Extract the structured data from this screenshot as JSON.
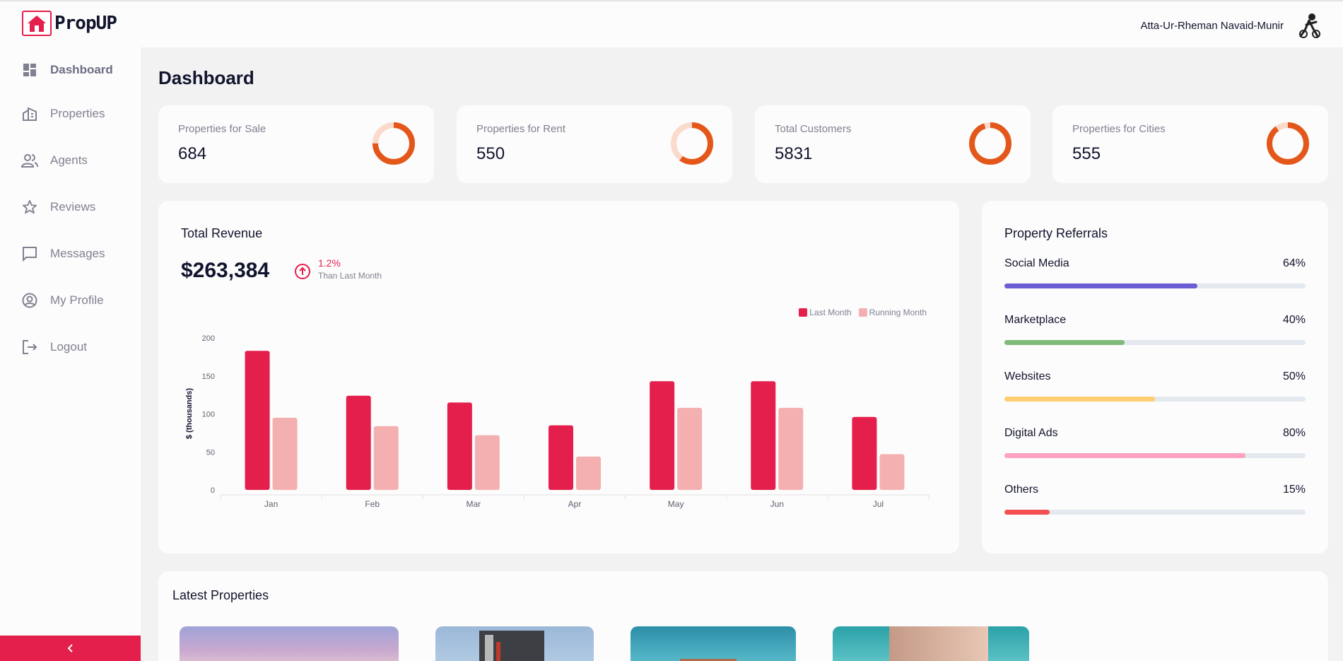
{
  "app": {
    "name": "PropUP"
  },
  "user": {
    "name": "Atta-Ur-Rheman Navaid-Munir"
  },
  "sidebar": {
    "items": [
      {
        "label": "Dashboard",
        "icon": "dashboard-icon",
        "active": true
      },
      {
        "label": "Properties",
        "icon": "building-icon"
      },
      {
        "label": "Agents",
        "icon": "people-icon"
      },
      {
        "label": "Reviews",
        "icon": "star-icon"
      },
      {
        "label": "Messages",
        "icon": "message-icon"
      },
      {
        "label": "My Profile",
        "icon": "account-circle-icon"
      },
      {
        "label": "Logout",
        "icon": "logout-icon"
      }
    ]
  },
  "page": {
    "title": "Dashboard"
  },
  "stats": [
    {
      "label": "Properties for Sale",
      "value": "684",
      "fraction": 0.75
    },
    {
      "label": "Properties for Rent",
      "value": "550",
      "fraction": 0.6
    },
    {
      "label": "Total Customers",
      "value": "5831",
      "fraction": 0.95
    },
    {
      "label": "Properties for Cities",
      "value": "555",
      "fraction": 0.9
    }
  ],
  "revenue": {
    "title": "Total Revenue",
    "amount": "$263,384",
    "trend_pct": "1.2%",
    "trend_sub": "Than Last Month"
  },
  "chart_data": {
    "type": "bar",
    "categories": [
      "Jan",
      "Feb",
      "Mar",
      "Apr",
      "May",
      "Jun",
      "Jul"
    ],
    "series": [
      {
        "name": "Last Month",
        "values": [
          183,
          124,
          115,
          85,
          143,
          143,
          96
        ],
        "color": "#e41f4c"
      },
      {
        "name": "Running Month",
        "values": [
          95,
          84,
          72,
          44,
          108,
          108,
          47
        ],
        "color": "#f4b0b0"
      }
    ],
    "ylabel": "$ (thousands)",
    "ylim": [
      0,
      200
    ],
    "yticks": [
      0,
      50,
      100,
      150,
      200
    ],
    "legend": "top-right"
  },
  "referrals": {
    "title": "Property Referrals",
    "items": [
      {
        "label": "Social Media",
        "pct_text": "64%",
        "value": 64,
        "color": "#6c5dd3"
      },
      {
        "label": "Marketplace",
        "pct_text": "40%",
        "value": 40,
        "color": "#7fba7a"
      },
      {
        "label": "Websites",
        "pct_text": "50%",
        "value": 50,
        "color": "#ffce73"
      },
      {
        "label": "Digital Ads",
        "pct_text": "80%",
        "value": 80,
        "color": "#ffa2c0"
      },
      {
        "label": "Others",
        "pct_text": "15%",
        "value": 15,
        "color": "#f45252"
      }
    ]
  },
  "latest": {
    "title": "Latest Properties"
  },
  "colors": {
    "accent": "#e41f4c",
    "donut": "#e4571a",
    "donut_track": "#fbdacb"
  }
}
